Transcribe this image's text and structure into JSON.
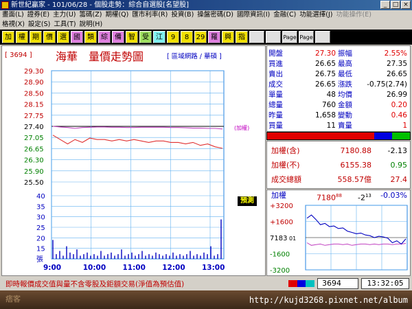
{
  "window": {
    "title": "新世紀贏家 - 101/06/28 - 個股走勢：綜合自選股[名望股]"
  },
  "menus": {
    "row1": [
      {
        "label": "畫面(L)",
        "enabled": true
      },
      {
        "label": "證券(E)",
        "enabled": true
      },
      {
        "label": "主力(U)",
        "enabled": true
      },
      {
        "label": "籌碼(Z)",
        "enabled": true
      },
      {
        "label": "期權(Q)",
        "enabled": true
      },
      {
        "label": "匯市利率(R)",
        "enabled": true
      },
      {
        "label": "投資(B)",
        "enabled": true
      },
      {
        "label": "操盤密碼(D)",
        "enabled": true
      },
      {
        "label": "國際資訊(I)",
        "enabled": true
      },
      {
        "label": "金融(C)",
        "enabled": true
      },
      {
        "label": "功能選擇(J)",
        "enabled": true
      },
      {
        "label": "功能操作(E)",
        "enabled": false
      }
    ],
    "row2": [
      {
        "label": "格視(X)",
        "enabled": true
      },
      {
        "label": "設定(S)",
        "enabled": true
      },
      {
        "label": "工具(T)",
        "enabled": true
      },
      {
        "label": "說明(H)",
        "enabled": true
      }
    ]
  },
  "toolbar": [
    {
      "label": "加",
      "style": "yel"
    },
    {
      "label": "權",
      "style": "yel"
    },
    {
      "label": "期",
      "style": "yel"
    },
    {
      "label": "價",
      "style": "yel"
    },
    {
      "label": "選",
      "style": "yel"
    },
    {
      "label": "國",
      "style": "pink"
    },
    {
      "label": "類",
      "style": "yel"
    },
    {
      "label": "綜",
      "style": "pink"
    },
    {
      "label": "備",
      "style": "pink"
    },
    {
      "label": "智",
      "style": "yel"
    },
    {
      "label": "受",
      "style": "grn"
    },
    {
      "label": "江",
      "style": "cyan"
    },
    {
      "label": "9",
      "style": "yel"
    },
    {
      "label": "8",
      "style": "yel"
    },
    {
      "label": "29",
      "style": "yel"
    },
    {
      "label": "羅",
      "style": "pink"
    },
    {
      "label": "興",
      "style": "yel"
    },
    {
      "label": "指",
      "style": "yel"
    },
    {
      "label": "",
      "style": "icon"
    },
    {
      "label": "",
      "style": "icon"
    },
    {
      "label": "Page",
      "style": "icon"
    },
    {
      "label": "Page",
      "style": "icon"
    },
    {
      "label": "",
      "style": "icon"
    }
  ],
  "stock": {
    "code": "[ 3694 ]",
    "title": "海華　量價走勢圖",
    "region_link": "[ 區域網路 / 華碩 ]",
    "chart_note": "(加權)",
    "predict_label": "預測"
  },
  "chart_data": {
    "type": "line",
    "price_ticks": [
      "29.30",
      "28.90",
      "28.50",
      "28.15",
      "27.75",
      "27.40",
      "27.05",
      "26.65",
      "26.30",
      "25.90",
      "25.50"
    ],
    "volume_ticks": [
      "40",
      "35",
      "30",
      "25",
      "20",
      "15",
      "張"
    ],
    "time_ticks": [
      "9:00",
      "10:00",
      "11:00",
      "12:00",
      "13:00"
    ],
    "reference_price": 27.4,
    "price_min": 25.5,
    "price_max": 29.3,
    "volume_max": 40,
    "series": [
      {
        "values": [
          27.4,
          27.38,
          27.36,
          27.33,
          27.36,
          27.37,
          27.38,
          27.38,
          27.37,
          27.37,
          27.36,
          27.36,
          27.37,
          27.37,
          27.37,
          27.37,
          27.36,
          27.36,
          27.35,
          27.34,
          27.34,
          27.33,
          27.33,
          27.31
        ]
      },
      {
        "values": [
          27.1,
          26.95,
          26.8,
          26.95,
          26.85,
          27.0,
          26.95,
          26.95,
          26.9,
          26.95,
          26.9,
          26.95,
          26.9,
          26.85,
          26.9,
          26.9,
          26.85,
          26.85,
          26.8,
          26.85,
          26.75,
          26.8,
          26.7,
          26.65
        ]
      }
    ],
    "volumes": [
      12,
      3,
      5,
      2,
      8,
      4,
      3,
      6,
      2,
      3,
      4,
      2,
      3,
      2,
      5,
      2,
      3,
      4,
      2,
      3,
      6,
      2,
      3,
      4,
      2,
      3,
      5,
      2,
      3,
      2,
      4,
      3,
      2,
      3,
      2,
      4,
      2,
      3,
      2,
      3,
      5,
      2,
      3,
      2,
      4,
      3,
      8,
      2,
      3,
      25
    ]
  },
  "quote": {
    "rows": [
      {
        "l1": "開盤",
        "v1": "27.30",
        "l2": "振幅",
        "v2": "2.55%",
        "v2c": "red"
      },
      {
        "l1": "買進",
        "v1": "26.65",
        "l2": "最高",
        "v2": "27.35",
        "v2c": ""
      },
      {
        "l1": "賣出",
        "v1": "26.75",
        "l2": "最低",
        "v2": "26.65",
        "v2c": ""
      },
      {
        "l1": "成交",
        "v1": "26.65",
        "l2": "漲跌",
        "v2": "-0.75(2.74)",
        "v2c": ""
      },
      {
        "l1": "單量",
        "v1": "48",
        "l2": "均價",
        "v2": "26.99",
        "v2c": ""
      },
      {
        "l1": "總量",
        "v1": "760",
        "l2": "金額",
        "v2": "0.20",
        "v2c": "red"
      },
      {
        "l1": "昨量",
        "v1": "1,658",
        "l2": "變動",
        "v2": "0.46",
        "v2c": "red"
      },
      {
        "l1": "買量",
        "v1": "11",
        "l2": "賣量",
        "v2": "1",
        "v2c": "red"
      }
    ],
    "ratio_colors": [
      "#e00000",
      "#e00000",
      "#e00000",
      "#0000e0",
      "#00c000"
    ]
  },
  "index": {
    "rows": [
      {
        "label": "加權(含)",
        "value": "7180.88",
        "change": "-2.13",
        "cc": "#000"
      },
      {
        "label": "加權(不)",
        "value": "6155.38",
        "change": "0.95",
        "cc": "#008000"
      },
      {
        "label": "成交總額",
        "value": "558.57億",
        "change": "27.4",
        "cc": "#c00000"
      }
    ]
  },
  "mini": {
    "label": "加權",
    "value": "7180",
    "value_sub": "88",
    "change": "-2",
    "change_sub": "13",
    "pct": "-0.03%",
    "ticks": [
      "+3200",
      "+1600",
      "7183",
      "-1600",
      "-3200"
    ],
    "tick_suffix": "01"
  },
  "status": {
    "text": "即時報價成交值與量不含零股及鉅額交易(淨值為預估值)",
    "code": "3694",
    "time": "13:32:05"
  },
  "footer": {
    "url": "http://kujd3268.pixnet.net/album",
    "logo": "痞客"
  }
}
